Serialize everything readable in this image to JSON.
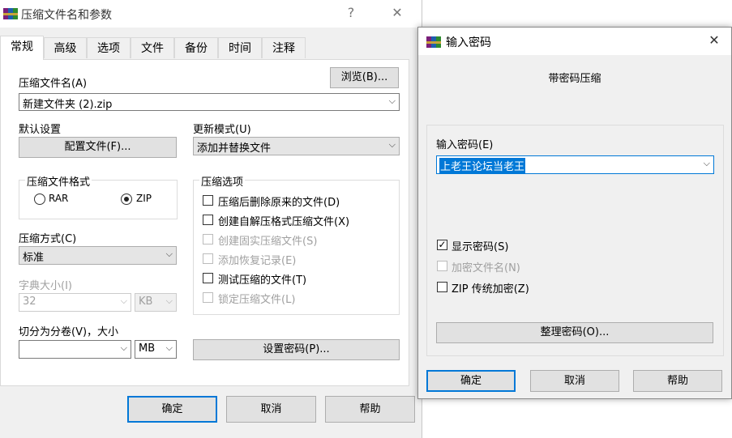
{
  "main_dialog": {
    "title": "压缩文件名和参数",
    "help_glyph": "?",
    "close_glyph": "✕",
    "tabs": [
      "常规",
      "高级",
      "选项",
      "文件",
      "备份",
      "时间",
      "注释"
    ],
    "archive_name_label": "压缩文件名(A)",
    "browse_button": "浏览(B)...",
    "archive_name_value": "新建文件夹 (2).zip",
    "default_settings_label": "默认设置",
    "profiles_button": "配置文件(F)...",
    "update_mode_label": "更新模式(U)",
    "update_mode_value": "添加并替换文件",
    "format_group_label": "压缩文件格式",
    "format_rar": "RAR",
    "format_zip": "ZIP",
    "selected_format": "ZIP",
    "options_group_label": "压缩选项",
    "options": [
      {
        "label": "压缩后删除原来的文件(D)",
        "checked": false,
        "enabled": true
      },
      {
        "label": "创建自解压格式压缩文件(X)",
        "checked": false,
        "enabled": true
      },
      {
        "label": "创建固实压缩文件(S)",
        "checked": false,
        "enabled": false
      },
      {
        "label": "添加恢复记录(E)",
        "checked": false,
        "enabled": false
      },
      {
        "label": "测试压缩的文件(T)",
        "checked": false,
        "enabled": true
      },
      {
        "label": "锁定压缩文件(L)",
        "checked": false,
        "enabled": false
      }
    ],
    "method_label": "压缩方式(C)",
    "method_value": "标准",
    "dict_size_label": "字典大小(I)",
    "dict_size_value": "32",
    "dict_unit_value": "KB",
    "split_label": "切分为分卷(V)，大小",
    "split_value": "",
    "split_unit_value": "MB",
    "set_password_button": "设置密码(P)...",
    "ok_button": "确定",
    "cancel_button": "取消",
    "help_button": "帮助"
  },
  "password_dialog": {
    "title": "输入密码",
    "close_glyph": "✕",
    "subtitle": "带密码压缩",
    "password_label": "输入密码(E)",
    "password_value": "上老王论坛当老王",
    "show_password_label": "显示密码(S)",
    "show_password_checked": true,
    "encrypt_names_label": "加密文件名(N)",
    "encrypt_names_enabled": false,
    "zip_legacy_label": "ZIP 传统加密(Z)",
    "zip_legacy_checked": false,
    "organize_button": "整理密码(O)...",
    "ok_button": "确定",
    "cancel_button": "取消",
    "help_button": "帮助"
  },
  "icons": {
    "app_icon": "winrar-books-icon",
    "dropdown": "chevron-down-icon",
    "check": "checkmark-icon"
  },
  "colors": {
    "accent": "#0078d7",
    "window_bg": "#f0f0f0",
    "button_bg": "#e1e1e1",
    "disabled_text": "#a0a0a0"
  }
}
